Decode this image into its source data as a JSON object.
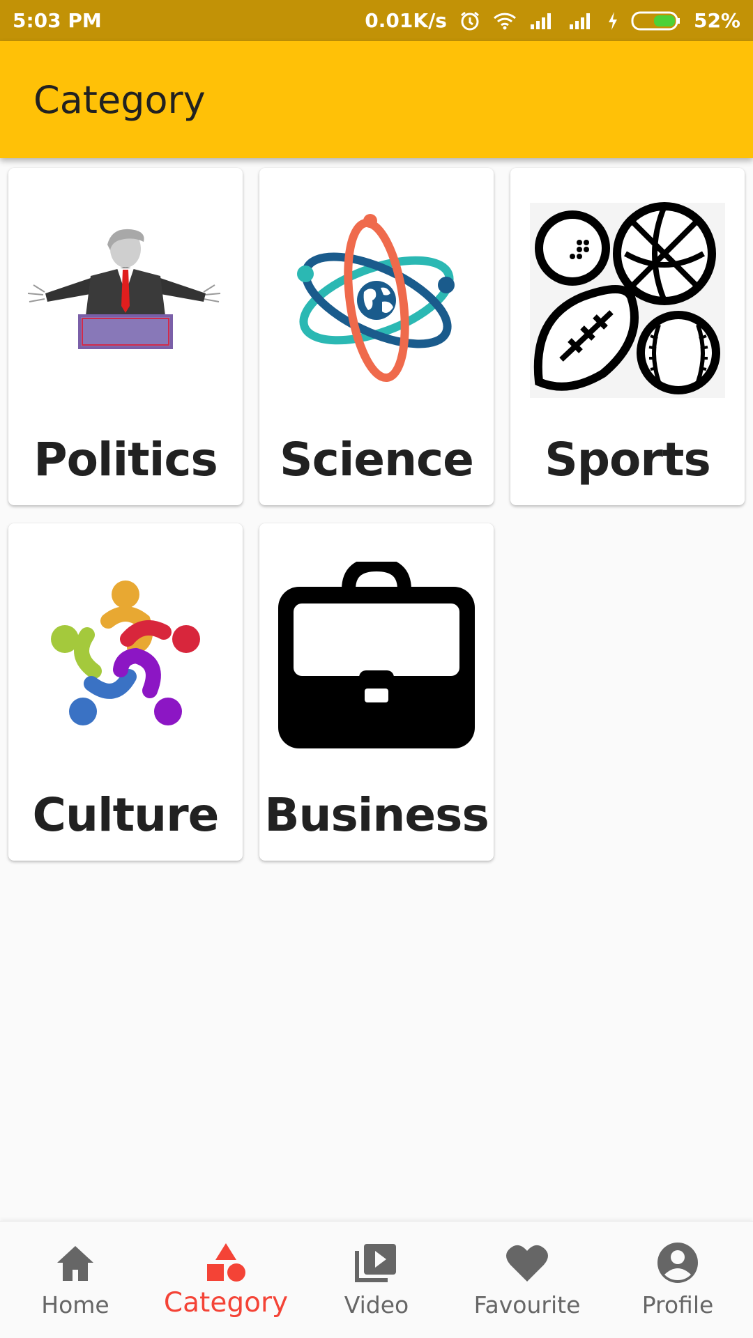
{
  "status_bar": {
    "time": "5:03 PM",
    "network_speed": "0.01K/s",
    "battery": "52%",
    "icons": [
      "alarm-icon",
      "wifi-icon",
      "signal-icon",
      "signal-icon",
      "charging-icon",
      "battery-icon"
    ]
  },
  "app_bar": {
    "title": "Category"
  },
  "categories": [
    {
      "label": "Politics",
      "icon": "politician-podium-image"
    },
    {
      "label": "Science",
      "icon": "atom-globe-image"
    },
    {
      "label": "Sports",
      "icon": "sports-balls-image"
    },
    {
      "label": "Culture",
      "icon": "people-circle-image"
    },
    {
      "label": "Business",
      "icon": "briefcase-image"
    }
  ],
  "bottom_nav": {
    "items": [
      {
        "label": "Home",
        "icon": "home-icon",
        "active": false
      },
      {
        "label": "Category",
        "icon": "category-shapes-icon",
        "active": true
      },
      {
        "label": "Video",
        "icon": "video-library-icon",
        "active": false
      },
      {
        "label": "Favourite",
        "icon": "heart-icon",
        "active": false
      },
      {
        "label": "Profile",
        "icon": "account-circle-icon",
        "active": false
      }
    ]
  },
  "colors": {
    "status_bar": "#c29206",
    "app_bar": "#ffc107",
    "active_nav": "#f44336",
    "inactive_nav": "#666666"
  }
}
